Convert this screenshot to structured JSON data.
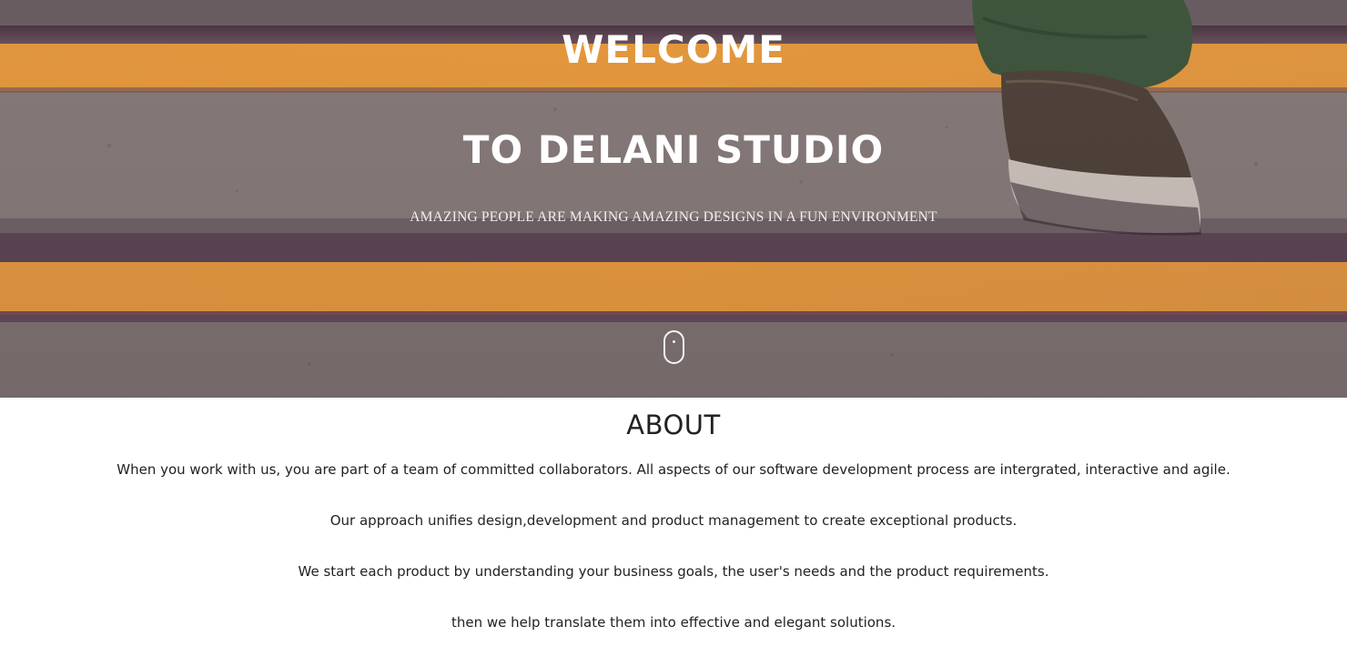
{
  "hero": {
    "title_line1": "WELCOME",
    "title_line2": "TO DELANI STUDIO",
    "subtitle": "AMAZING PEOPLE ARE MAKING AMAZING DESIGNS IN A FUN ENVIRONMENT",
    "scroll_icon": "mouse-scroll-icon"
  },
  "about": {
    "heading": "ABOUT",
    "paragraphs": [
      "When you work with us, you are part of a team of committed collaborators. All aspects of our software development process are intergrated, interactive and agile.",
      "Our approach unifies design,development and product management to create exceptional products.",
      "We start each product by understanding your business goals, the user's needs and the product requirements.",
      "then we help translate them into effective and elegant solutions."
    ]
  },
  "colors": {
    "stripe_orange": "#f0a23a",
    "concrete_gray": "#7e7770",
    "text_dark": "#222222",
    "hero_text": "#ffffff"
  }
}
